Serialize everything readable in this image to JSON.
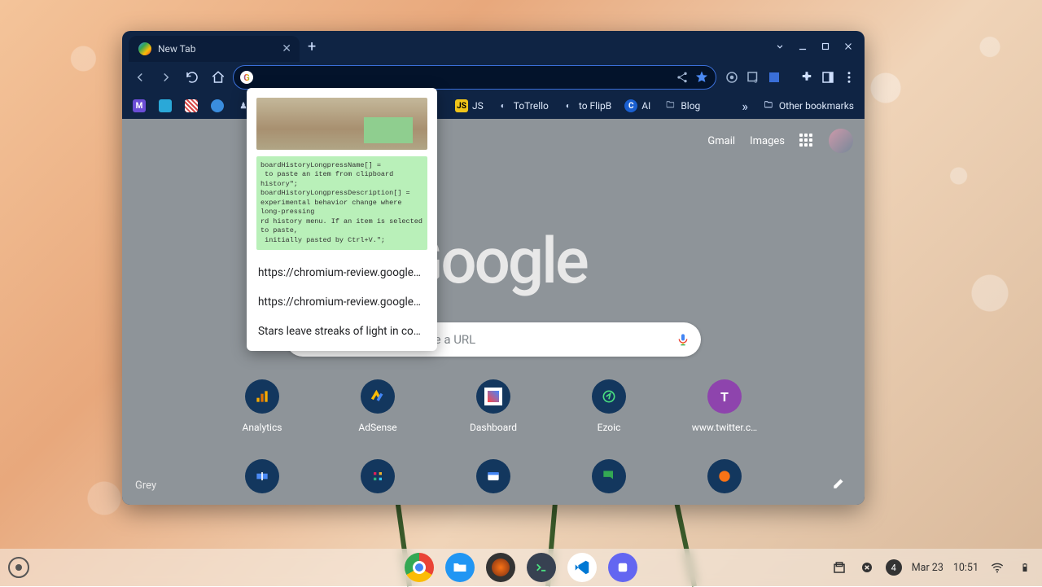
{
  "tab": {
    "title": "New Tab"
  },
  "bookmarks": {
    "items": [
      {
        "label": "",
        "color": "#6b4dd6"
      },
      {
        "label": "",
        "color": "#2aa8d8"
      },
      {
        "label": "",
        "color": "#d64545"
      },
      {
        "label": "",
        "color": "#3a8dde"
      },
      {
        "label": "",
        "color": "#333333"
      },
      {
        "label": "JS",
        "color": "#f0c419"
      },
      {
        "label": "ToTrello",
        "color": "#333333"
      },
      {
        "label": "to FlipB",
        "color": "#333333"
      },
      {
        "label": "AI",
        "color": "#1a5fd0"
      },
      {
        "label": "Blog",
        "color": "#9fb3cf"
      }
    ],
    "other": "Other bookmarks",
    "overflow": "»"
  },
  "ntp": {
    "links": {
      "gmail": "Gmail",
      "images": "Images"
    },
    "logo": "Google",
    "search_placeholder": "Search Google or type a URL",
    "shortcuts": [
      {
        "label": "Analytics"
      },
      {
        "label": "AdSense"
      },
      {
        "label": "Dashboard"
      },
      {
        "label": "Ezoic"
      },
      {
        "label": "www.twitter.c…"
      }
    ],
    "theme": "Grey"
  },
  "clipboard": {
    "code": "boardHistoryLongpressName[] =\n to paste an item from clipboard history\";\nboardHistoryLongpressDescription[] =\nexperimental behavior change where long-pressing\nrd history menu. If an item is selected to paste,\n initially pasted by Ctrl+V.\";",
    "items": [
      "https://chromium-review.googleso…",
      "https://chromium-review.googleso…",
      "Stars leave streaks of light in conc…"
    ]
  },
  "shelf": {
    "date": "Mar 23",
    "time": "10:51",
    "badge": "4"
  }
}
